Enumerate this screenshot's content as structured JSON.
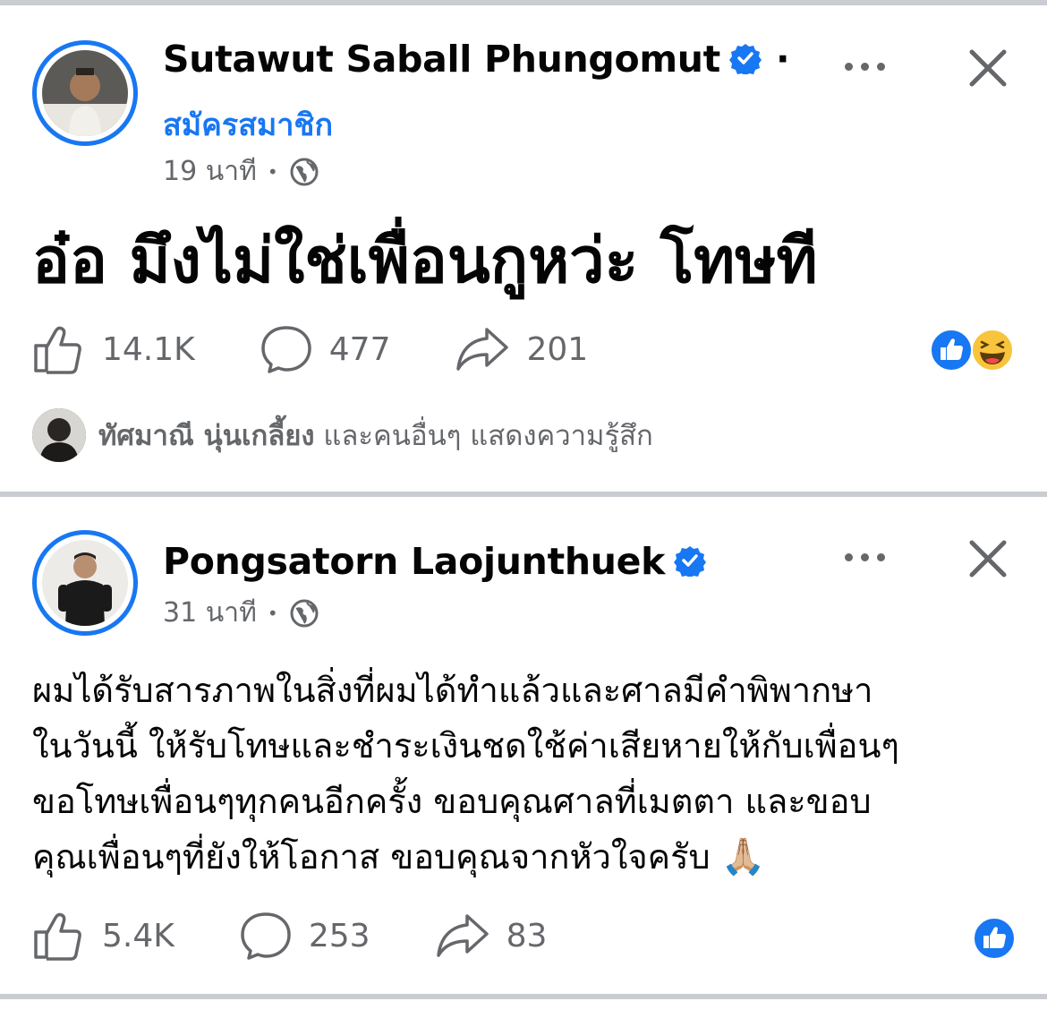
{
  "post1": {
    "author": "Sutawut Saball Phungomut",
    "separator": "·",
    "follow_label": "สมัครสมาชิก",
    "time": "19 นาที",
    "meta_dot": "•",
    "text": "อ๋อ มึงไม่ใช่เพื่อนกูหว่ะ โทษที",
    "likes": "14.1K",
    "comments": "477",
    "shares": "201",
    "reactor_name": "ทัศมาณี นุ่นเกลี้ยง",
    "reactor_suffix": " และคนอื่นๆ แสดงความรู้สึก"
  },
  "post2": {
    "author": "Pongsatorn Laojunthuek",
    "time": "31 นาที",
    "meta_dot": "•",
    "text_lines": [
      "ผมได้รับสารภาพในสิ่งที่ผมได้ทำแล้วและศาลมีคำพิพากษา",
      "ในวันนี้ ให้รับโทษและชำระเงินชดใช้ค่าเสียหายให้กับเพื่อนๆ",
      "ขอโทษเพื่อนๆทุกคนอีกครั้ง ขอบคุณศาลที่เมตตา และขอบ",
      "คุณเพื่อนๆที่ยังให้โอกาส ขอบคุณจากหัวใจครับ"
    ],
    "pray_emoji": "🙏🏼",
    "likes": "5.4K",
    "comments": "253",
    "shares": "83"
  },
  "colors": {
    "accent": "#1877f2",
    "muted": "#65676b",
    "divider": "#c9ccd1"
  },
  "icons": [
    "verified-badge-icon",
    "more-options-icon",
    "close-icon",
    "globe-icon",
    "like-icon",
    "comment-icon",
    "share-icon",
    "like-reaction-icon",
    "haha-reaction-icon"
  ]
}
